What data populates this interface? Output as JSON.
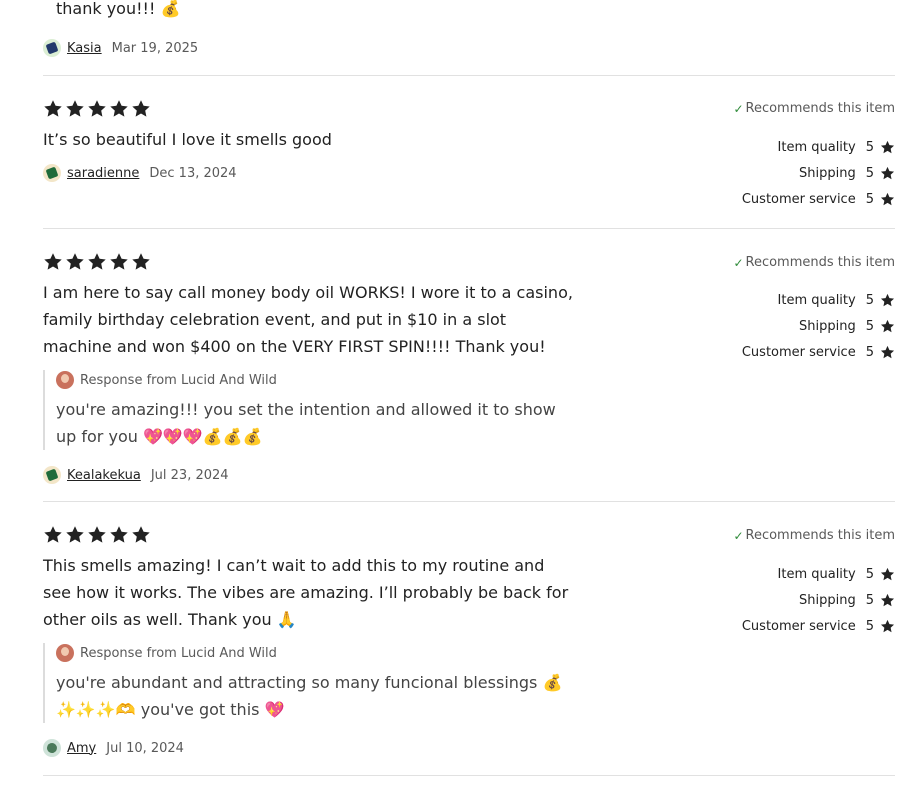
{
  "colors": {
    "star": "#222222",
    "check": "#2f8b3a",
    "divider": "#e1e1e1"
  },
  "star_icon": "star-icon",
  "reviews": [
    {
      "text": "thank you!!! 💰",
      "user": "Kasia",
      "date": "Mar 19, 2025",
      "avatar_color": "#22396b",
      "avatar_bg": "#dbeed4"
    },
    {
      "stars": 5,
      "text": "It’s so beautiful I love it smells good",
      "user": "saradienne",
      "date": "Dec 13, 2024",
      "avatar_color": "#1f6b3a",
      "avatar_bg": "#f3e6c8",
      "recommend": "Recommends this item",
      "ratings": [
        {
          "label": "Item quality",
          "value": "5"
        },
        {
          "label": "Shipping",
          "value": "5"
        },
        {
          "label": "Customer service",
          "value": "5"
        }
      ]
    },
    {
      "stars": 5,
      "text": "I am here to say call money body oil WORKS! I wore it to a casino, family birthday celebration event, and put in $10 in a slot machine and won $400 on the VERY FIRST SPIN!!!! Thank you!",
      "response_from": "Response from Lucid And Wild",
      "response_text": "you're amazing!!! you set the intention and allowed it to show up for you 💖💖💖💰💰💰",
      "user": "Kealakekua",
      "date": "Jul 23, 2024",
      "avatar_color": "#1f6b3a",
      "avatar_bg": "#f3e6c8",
      "recommend": "Recommends this item",
      "ratings": [
        {
          "label": "Item quality",
          "value": "5"
        },
        {
          "label": "Shipping",
          "value": "5"
        },
        {
          "label": "Customer service",
          "value": "5"
        }
      ]
    },
    {
      "stars": 5,
      "text": "This smells amazing! I can’t wait to add this to my routine and see how it works. The vibes are amazing. I’ll probably be back for other oils as well. Thank you 🙏",
      "response_from": "Response from Lucid And Wild",
      "response_text": "you're abundant and attracting so many funcional blessings 💰 ✨✨✨🫶 you've got this 💖",
      "user": "Amy",
      "date": "Jul 10, 2024",
      "avatar_color": "#4a7a5a",
      "avatar_bg": "#cfe3d9",
      "recommend": "Recommends this item",
      "ratings": [
        {
          "label": "Item quality",
          "value": "5"
        },
        {
          "label": "Shipping",
          "value": "5"
        },
        {
          "label": "Customer service",
          "value": "5"
        }
      ]
    }
  ]
}
